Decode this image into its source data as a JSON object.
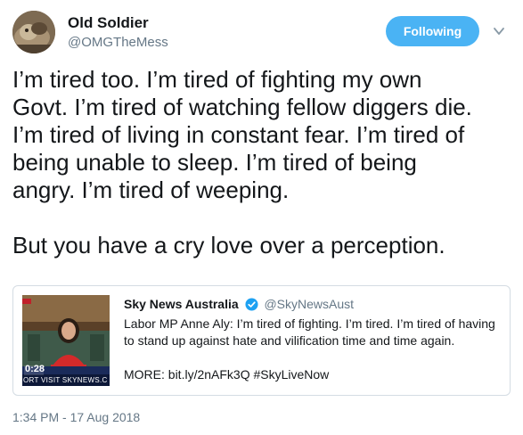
{
  "author": {
    "display_name": "Old Soldier",
    "handle": "@OMGTheMess"
  },
  "follow_button": {
    "label": "Following",
    "color": "#4ab3f4"
  },
  "menu": {
    "icon": "chevron-down-icon"
  },
  "tweet": {
    "paragraph1_lines": [
      "I’m tired too. I’m tired of fighting my own",
      "Govt. I’m tired of watching fellow diggers die.",
      "I’m tired of living in constant fear. I’m tired of",
      "being unable to sleep. I’m tired of being",
      "angry. I’m tired of weeping."
    ],
    "paragraph2": "But you have a cry love over a perception."
  },
  "quoted_tweet": {
    "author": "Sky News Australia",
    "handle": "@SkyNewsAust",
    "text_lines": [
      "Labor MP Anne Aly: I’m tired of fighting. I’m tired. I’m tired of having",
      "to stand up against hate and vilification time and time again."
    ],
    "more": "MORE: bit.ly/2nAFk3Q #SkyLiveNow",
    "media": {
      "clock": "0:28",
      "ticker": "ORT VISIT SKYNEWS.C"
    }
  },
  "timestamp": "1:34 PM - 17 Aug 2018"
}
